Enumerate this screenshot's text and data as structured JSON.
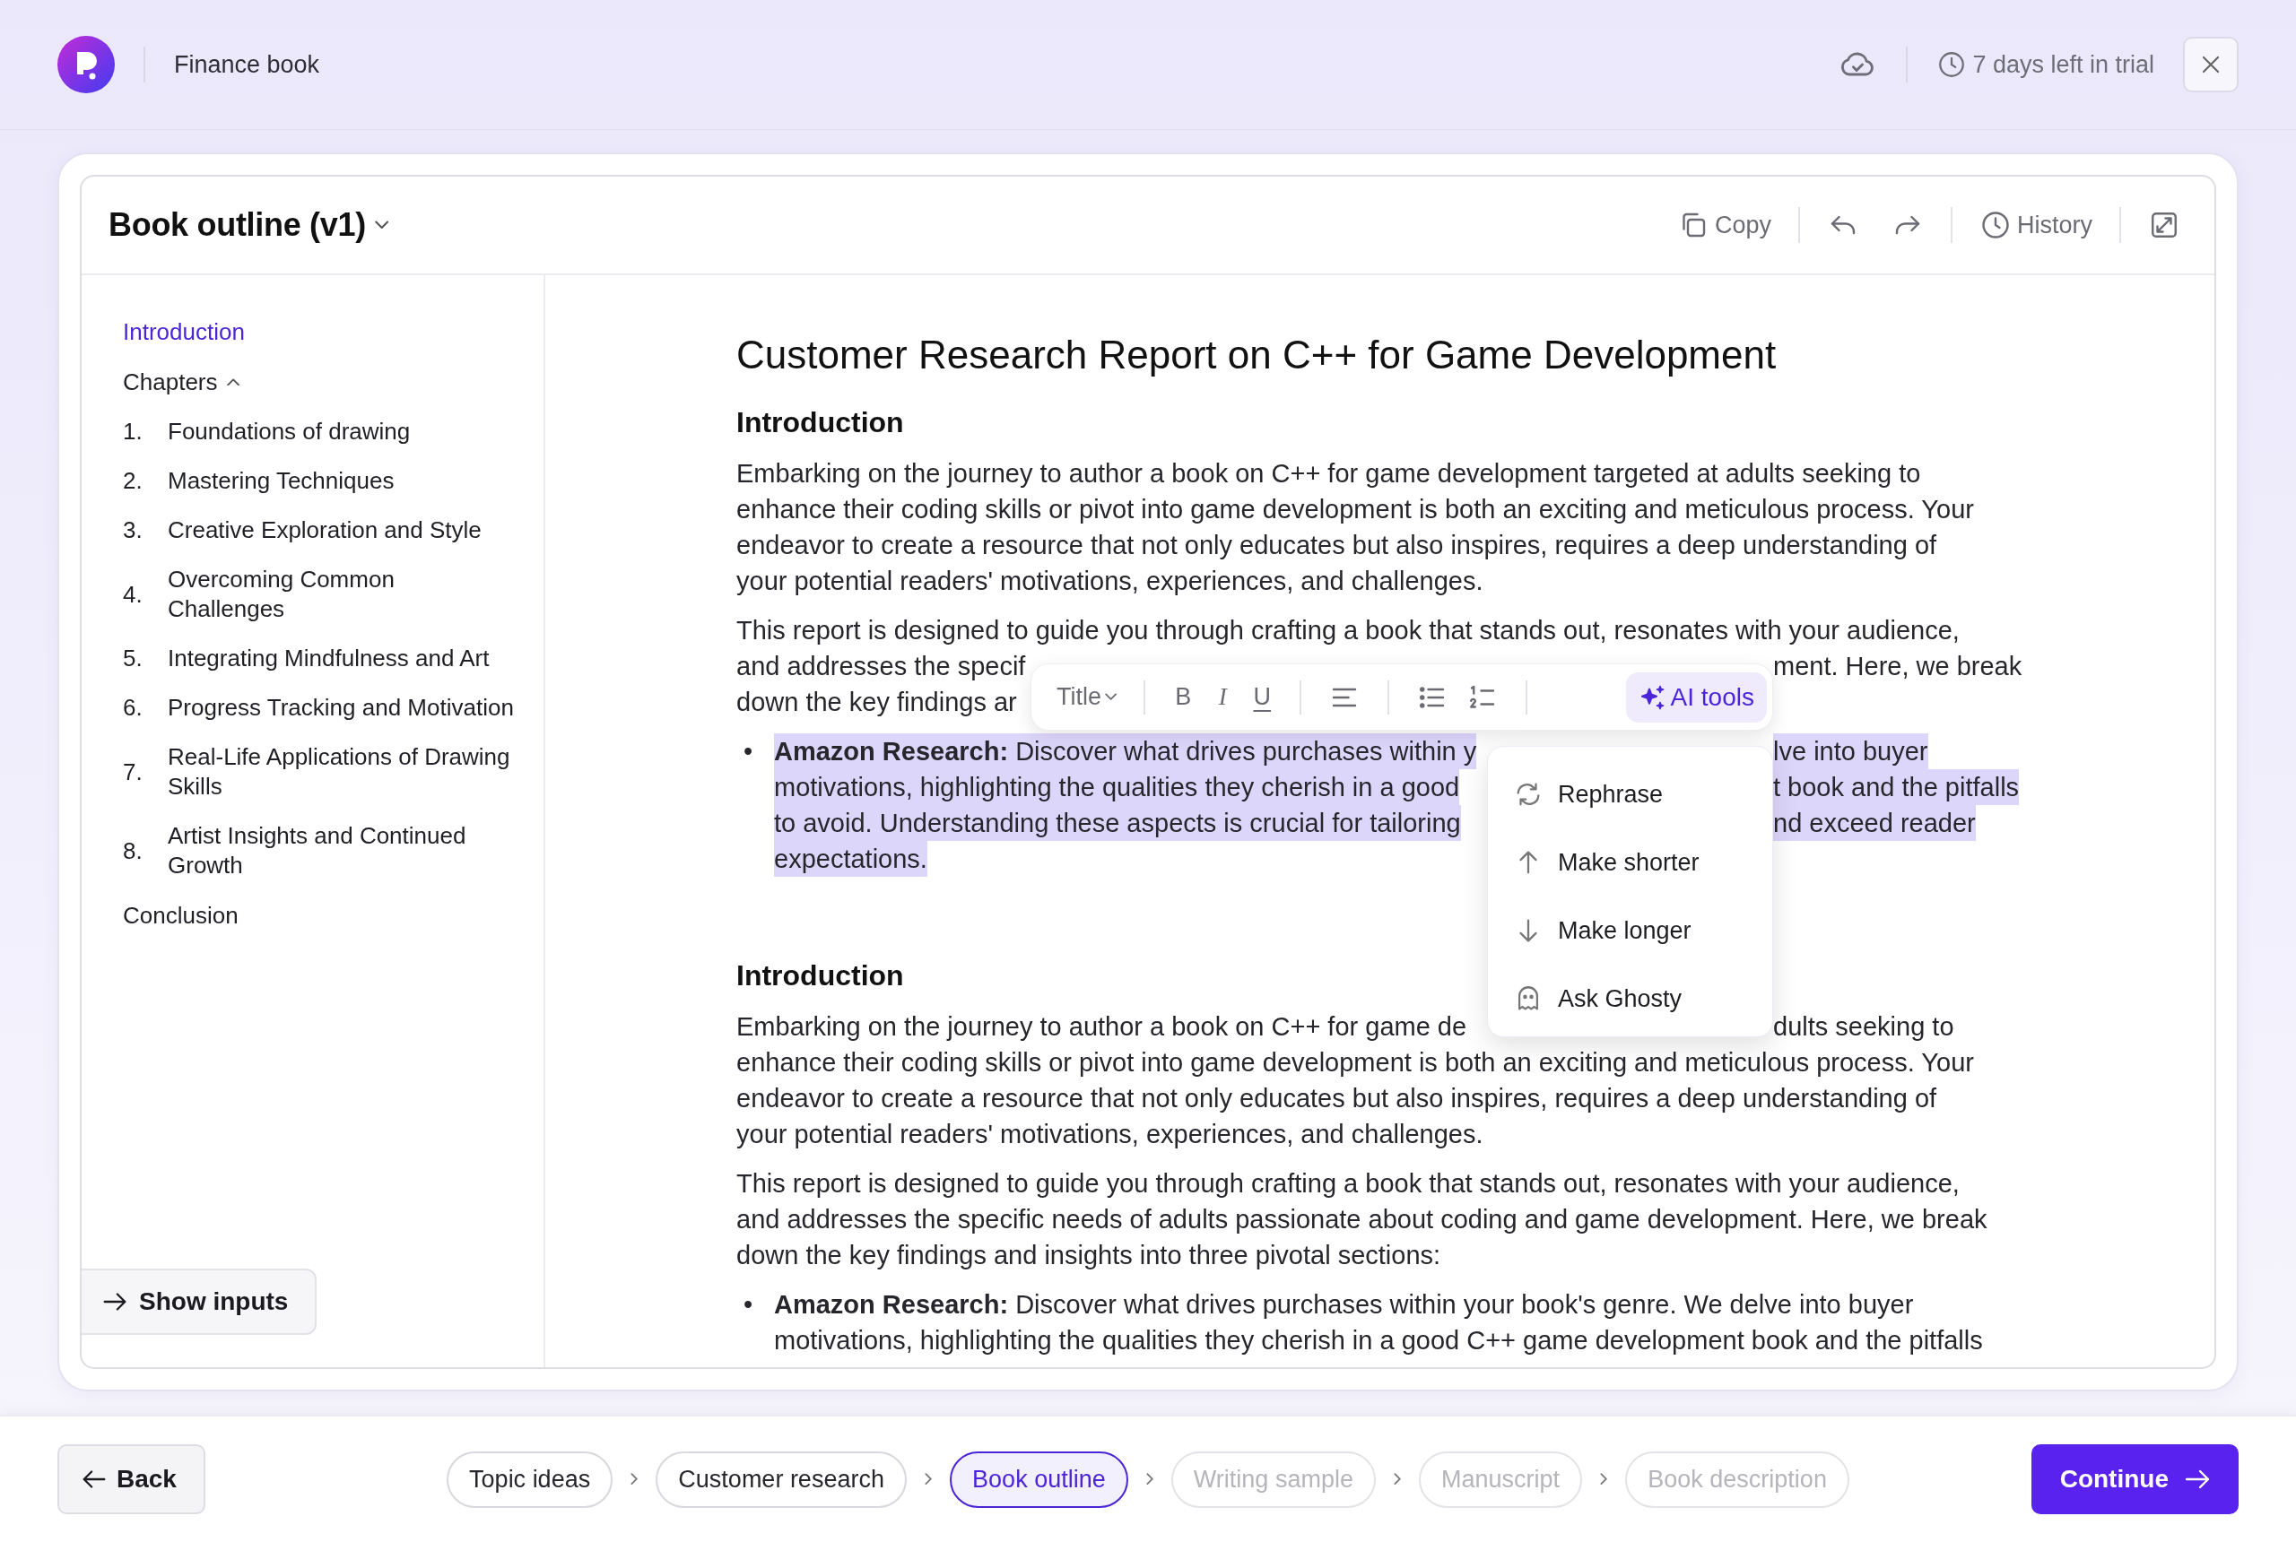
{
  "app": {
    "title": "Finance book",
    "trial": "7 days left in trial"
  },
  "panel": {
    "title": "Book outline (v1)",
    "actions": [
      {
        "kind": "copy",
        "label": "Copy"
      },
      {
        "kind": "undo"
      },
      {
        "kind": "redo"
      },
      {
        "kind": "history",
        "label": "History"
      },
      {
        "kind": "expand"
      }
    ]
  },
  "sidebar": {
    "items": [
      {
        "label": "Introduction",
        "selected": true
      },
      {
        "label": "Chapters",
        "selected": false,
        "expanded": true,
        "children": [
          {
            "number": "1.",
            "label": "Foundations of drawing",
            "selected": false
          },
          {
            "number": "2.",
            "label": "Mastering Techniques",
            "selected": false
          },
          {
            "number": "3.",
            "label": "Creative Exploration and Style",
            "selected": false
          },
          {
            "number": "4.",
            "label": "Overcoming Common Challenges",
            "selected": false
          },
          {
            "number": "5.",
            "label": "Integrating Mindfulness and Art",
            "selected": false
          },
          {
            "number": "6.",
            "label": "Progress Tracking and Motivation",
            "selected": false
          },
          {
            "number": "7.",
            "label": "Real-Life Applications of Drawing Skills",
            "selected": false
          },
          {
            "number": "8.",
            "label": "Artist Insights and Continued Growth",
            "selected": false
          }
        ]
      },
      {
        "label": "Conclusion",
        "selected": false
      }
    ],
    "button": "Show inputs"
  },
  "document": {
    "blocks": [
      {
        "kind": "title",
        "text": "Customer Research Report on C++ for Game Development"
      },
      {
        "kind": "heading",
        "text": "Introduction"
      },
      {
        "kind": "paragraph",
        "lines": [
          {
            "left": "Embarking on the journey to author a book on C++ for game development targeted at adults seeking to"
          },
          {
            "left": "enhance their coding skills or pivot into game development is both an exciting and meticulous process. Your"
          },
          {
            "left": "endeavor to create a resource that not only educates but also inspires, requires a deep understanding of"
          },
          {
            "left": "your potential readers' motivations, experiences, and challenges."
          }
        ]
      },
      {
        "kind": "paragraph",
        "lines": [
          {
            "left": "This report is designed to guide you through crafting a book that stands out, resonates with your audience,"
          },
          {
            "left": "and addresses the specif",
            "right": "ment. Here, we break"
          },
          {
            "left": "down the key findings ar"
          }
        ]
      },
      {
        "kind": "bullet",
        "bullet": "•",
        "selected": true,
        "lines": [
          {
            "left": "**Amazon Research:** Discover what drives purchases within y",
            "right": "lve into buyer"
          },
          {
            "left": "motivations, highlighting the qualities they cherish in a good",
            "right": "t book and the pitfalls"
          },
          {
            "left": "to avoid. Understanding these aspects is crucial for tailoring",
            "right": "nd exceed reader"
          },
          {
            "left": "expectations."
          }
        ]
      },
      {
        "kind": "heading",
        "text": "Introduction"
      },
      {
        "kind": "paragraph",
        "lines": [
          {
            "left": "Embarking on the journey to author a book on C++ for game de",
            "right": "dults seeking to"
          },
          {
            "left": "enhance their coding skills or pivot into game development is both an exciting and meticulous process. Your"
          },
          {
            "left": "endeavor to create a resource that not only educates but also inspires, requires a deep understanding of"
          },
          {
            "left": "your potential readers' motivations, experiences, and challenges."
          }
        ]
      },
      {
        "kind": "paragraph",
        "lines": [
          {
            "left": "This report is designed to guide you through crafting a book that stands out, resonates with your audience,"
          },
          {
            "left": "and addresses the specific needs of adults passionate about coding and game development. Here, we break"
          },
          {
            "left": "down the key findings and insights into three pivotal sections:"
          }
        ]
      },
      {
        "kind": "bullet",
        "bullet": "•",
        "selected": false,
        "lines": [
          {
            "left": "**Amazon Research:** Discover what drives purchases within your book's genre. We delve into buyer"
          },
          {
            "left": "motivations, highlighting the qualities they cherish in a good C++ game development book and the pitfalls"
          }
        ]
      }
    ]
  },
  "toolbar": {
    "style": "Title",
    "buttons": [
      {
        "kind": "bold",
        "glyph": "B"
      },
      {
        "kind": "italic",
        "glyph": "I"
      },
      {
        "kind": "underline",
        "glyph": "U"
      },
      {
        "kind": "align"
      },
      {
        "kind": "bullets"
      },
      {
        "kind": "numbers"
      }
    ],
    "ai": {
      "label": "AI tools",
      "selected": true
    }
  },
  "ai_menu": [
    {
      "kind": "rephrase",
      "label": "Rephrase"
    },
    {
      "kind": "shorter",
      "label": "Make shorter"
    },
    {
      "kind": "longer",
      "label": "Make longer"
    },
    {
      "kind": "ghost",
      "label": "Ask Ghosty"
    }
  ],
  "footer": {
    "back": "Back",
    "continue": "Continue",
    "steps": [
      {
        "label": "Topic ideas",
        "selected": false,
        "disabled": false
      },
      {
        "label": "Customer research",
        "selected": false,
        "disabled": false
      },
      {
        "label": "Book outline",
        "selected": true,
        "disabled": false
      },
      {
        "label": "Writing sample",
        "selected": false,
        "disabled": true
      },
      {
        "label": "Manuscript",
        "selected": false,
        "disabled": true
      },
      {
        "label": "Book description",
        "selected": false,
        "disabled": true
      }
    ]
  }
}
